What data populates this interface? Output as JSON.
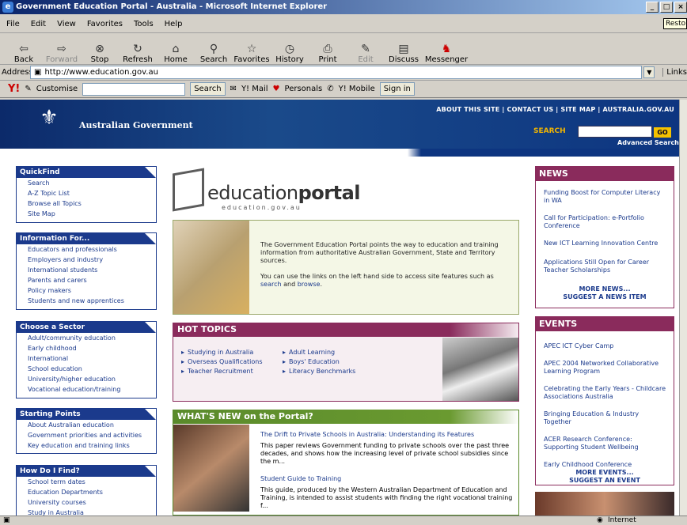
{
  "window": {
    "title": "Government Education Portal - Australia - Microsoft Internet Explorer",
    "restore_tip": "Resto"
  },
  "menu": [
    "File",
    "Edit",
    "View",
    "Favorites",
    "Tools",
    "Help"
  ],
  "toolbar": [
    {
      "label": "Back",
      "icon": "back-arrow-icon"
    },
    {
      "label": "Forward",
      "icon": "forward-arrow-icon"
    },
    {
      "label": "Stop",
      "icon": "stop-icon"
    },
    {
      "label": "Refresh",
      "icon": "refresh-icon"
    },
    {
      "label": "Home",
      "icon": "home-icon"
    },
    {
      "label": "Search",
      "icon": "search-icon"
    },
    {
      "label": "Favorites",
      "icon": "favorites-icon"
    },
    {
      "label": "History",
      "icon": "history-icon"
    },
    {
      "label": "Print",
      "icon": "print-icon"
    },
    {
      "label": "Edit",
      "icon": "edit-icon"
    },
    {
      "label": "Discuss",
      "icon": "discuss-icon"
    },
    {
      "label": "Messenger",
      "icon": "messenger-icon"
    }
  ],
  "address": {
    "label": "Address",
    "url": "http://www.education.gov.au",
    "links": "Links"
  },
  "yahoo": {
    "customise": "Customise",
    "search": "Search",
    "mail": "Y! Mail",
    "personals": "Personals",
    "mobile": "Y! Mobile",
    "signin": "Sign in"
  },
  "site": {
    "gov_name": "Australian Government",
    "top_links": "ABOUT THIS SITE | CONTACT US | SITE MAP | AUSTRALIA.GOV.AU",
    "search_label": "SEARCH",
    "go": "GO",
    "advanced": "Advanced Search",
    "logo_text_a": "education",
    "logo_text_b": "portal",
    "logo_sub": "education.gov.au"
  },
  "left_nav": [
    {
      "heading": "QuickFind",
      "items": [
        "Search",
        "A-Z Topic List",
        "Browse all Topics",
        "Site Map"
      ]
    },
    {
      "heading": "Information For...",
      "items": [
        "Educators and professionals",
        "Employers and industry",
        "International students",
        "Parents and carers",
        "Policy makers",
        "Students and new apprentices"
      ]
    },
    {
      "heading": "Choose a Sector",
      "items": [
        "Adult/community education",
        "Early childhood",
        "International",
        "School education",
        "University/higher education",
        "Vocational education/training"
      ]
    },
    {
      "heading": "Starting Points",
      "items": [
        "About Australian education",
        "Government priorities and activities",
        "Key education and training links"
      ]
    },
    {
      "heading": "How Do I Find?",
      "items": [
        "School term dates",
        "Education Departments",
        "University courses",
        "Study in Australia"
      ]
    }
  ],
  "intro": {
    "p1": "The Government Education Portal points the way to education and training information from authoritative Australian Government, State and Territory sources.",
    "p2a": "You can use the links on the left hand side to access site features such as ",
    "p2_search": "search",
    "p2_and": " and ",
    "p2_browse": "browse",
    "p2_end": "."
  },
  "hot_topics": {
    "heading": "HOT TOPICS",
    "col1": [
      "Studying in Australia",
      "Overseas Qualifications",
      "Teacher Recruitment"
    ],
    "col2": [
      "Adult Learning",
      "Boys' Education",
      "Literacy Benchmarks"
    ]
  },
  "whats_new": {
    "heading": "WHAT'S NEW on the Portal?",
    "items": [
      {
        "title": "The Drift to Private Schools in Australia: Understanding its Features",
        "body": "This paper reviews Government funding to private schools over the past three decades, and shows how the increasing level of private school subsidies since the m..."
      },
      {
        "title": "Student Guide to Training",
        "body": "This guide, produced by the Western Australian Department of Education and Training, is intended to assist students with finding the right vocational training f..."
      }
    ]
  },
  "news": {
    "heading": "NEWS",
    "items": [
      "Funding Boost for Computer Literacy in WA",
      "Call for Participation: e-Portfolio Conference",
      "New ICT Learning Innovation Centre",
      "Applications Still Open for Career Teacher Scholarships"
    ],
    "more": "MORE NEWS...",
    "suggest": "SUGGEST A NEWS ITEM"
  },
  "events": {
    "heading": "EVENTS",
    "items": [
      "APEC ICT Cyber Camp",
      "APEC 2004 Networked Collaborative Learning Program",
      "Celebrating the Early Years - Childcare Associations Australia",
      "Bringing Education & Industry Together",
      "ACER Research Conference: Supporting Student Wellbeing",
      "Early Childhood Conference"
    ],
    "more": "MORE EVENTS...",
    "suggest": "SUGGEST AN EVENT"
  },
  "status": {
    "zone": "Internet"
  }
}
